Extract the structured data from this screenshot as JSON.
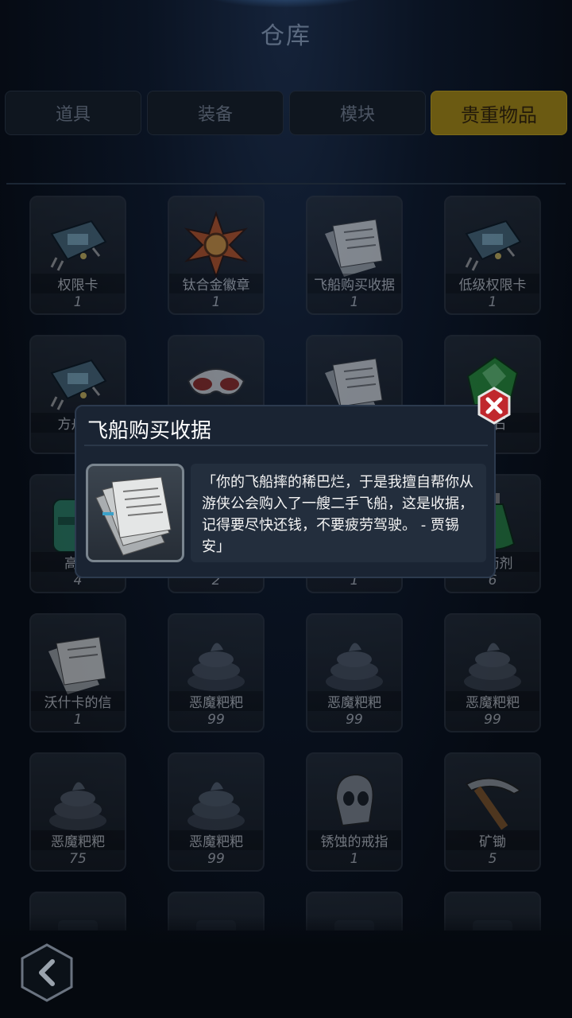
{
  "header": {
    "title": "仓库"
  },
  "tabs": [
    {
      "label": "道具",
      "active": false
    },
    {
      "label": "装备",
      "active": false
    },
    {
      "label": "模块",
      "active": false
    },
    {
      "label": "贵重物品",
      "active": true
    }
  ],
  "items": [
    {
      "name": "权限卡",
      "count": "1",
      "icon": "chip-card-icon"
    },
    {
      "name": "钛合金徽章",
      "count": "1",
      "icon": "star-badge-icon"
    },
    {
      "name": "飞船购买收据",
      "count": "1",
      "icon": "paper-receipt-icon"
    },
    {
      "name": "低级权限卡",
      "count": "1",
      "icon": "chip-card-icon"
    },
    {
      "name": "方舟权",
      "count": "",
      "icon": "chip-card-icon"
    },
    {
      "name": "",
      "count": "",
      "icon": "goggles-icon"
    },
    {
      "name": "",
      "count": "",
      "icon": "paper-receipt-icon"
    },
    {
      "name": "宝石",
      "count": "",
      "icon": "green-gem-icon"
    },
    {
      "name": "高爆",
      "count": "4",
      "icon": "canister-icon"
    },
    {
      "name": "",
      "count": "2",
      "icon": "unknown-item-icon"
    },
    {
      "name": "",
      "count": "1",
      "icon": "unknown-item-icon"
    },
    {
      "name": "强药剂",
      "count": "6",
      "icon": "potion-icon"
    },
    {
      "name": "沃什卡的信",
      "count": "1",
      "icon": "paper-letter-icon"
    },
    {
      "name": "恶魔粑粑",
      "count": "99",
      "icon": "poop-icon"
    },
    {
      "name": "恶魔粑粑",
      "count": "99",
      "icon": "poop-icon"
    },
    {
      "name": "恶魔粑粑",
      "count": "99",
      "icon": "poop-icon"
    },
    {
      "name": "恶魔粑粑",
      "count": "75",
      "icon": "poop-icon"
    },
    {
      "name": "恶魔粑粑",
      "count": "99",
      "icon": "poop-icon"
    },
    {
      "name": "锈蚀的戒指",
      "count": "1",
      "icon": "skull-ring-icon"
    },
    {
      "name": "矿锄",
      "count": "5",
      "icon": "pickaxe-icon"
    },
    {
      "name": "",
      "count": "",
      "icon": "unknown-item-icon"
    },
    {
      "name": "",
      "count": "",
      "icon": "unknown-item-icon"
    },
    {
      "name": "",
      "count": "",
      "icon": "unknown-item-icon"
    },
    {
      "name": "",
      "count": "",
      "icon": "unknown-item-icon"
    }
  ],
  "popup": {
    "title": "飞船购买收据",
    "icon": "paper-receipt-icon",
    "description": "「你的飞船摔的稀巴烂，于是我擅自帮你从游侠公会购入了一艘二手飞船，这是收据，记得要尽快还钱，不要疲劳驾驶。 - 贾锡安」",
    "close_icon": "close-icon"
  },
  "footer": {
    "back_icon": "back-arrow-icon"
  },
  "colors": {
    "active_tab": "#6b5a12",
    "popup_bg": "#1a2433",
    "close_red": "#c0282d"
  }
}
